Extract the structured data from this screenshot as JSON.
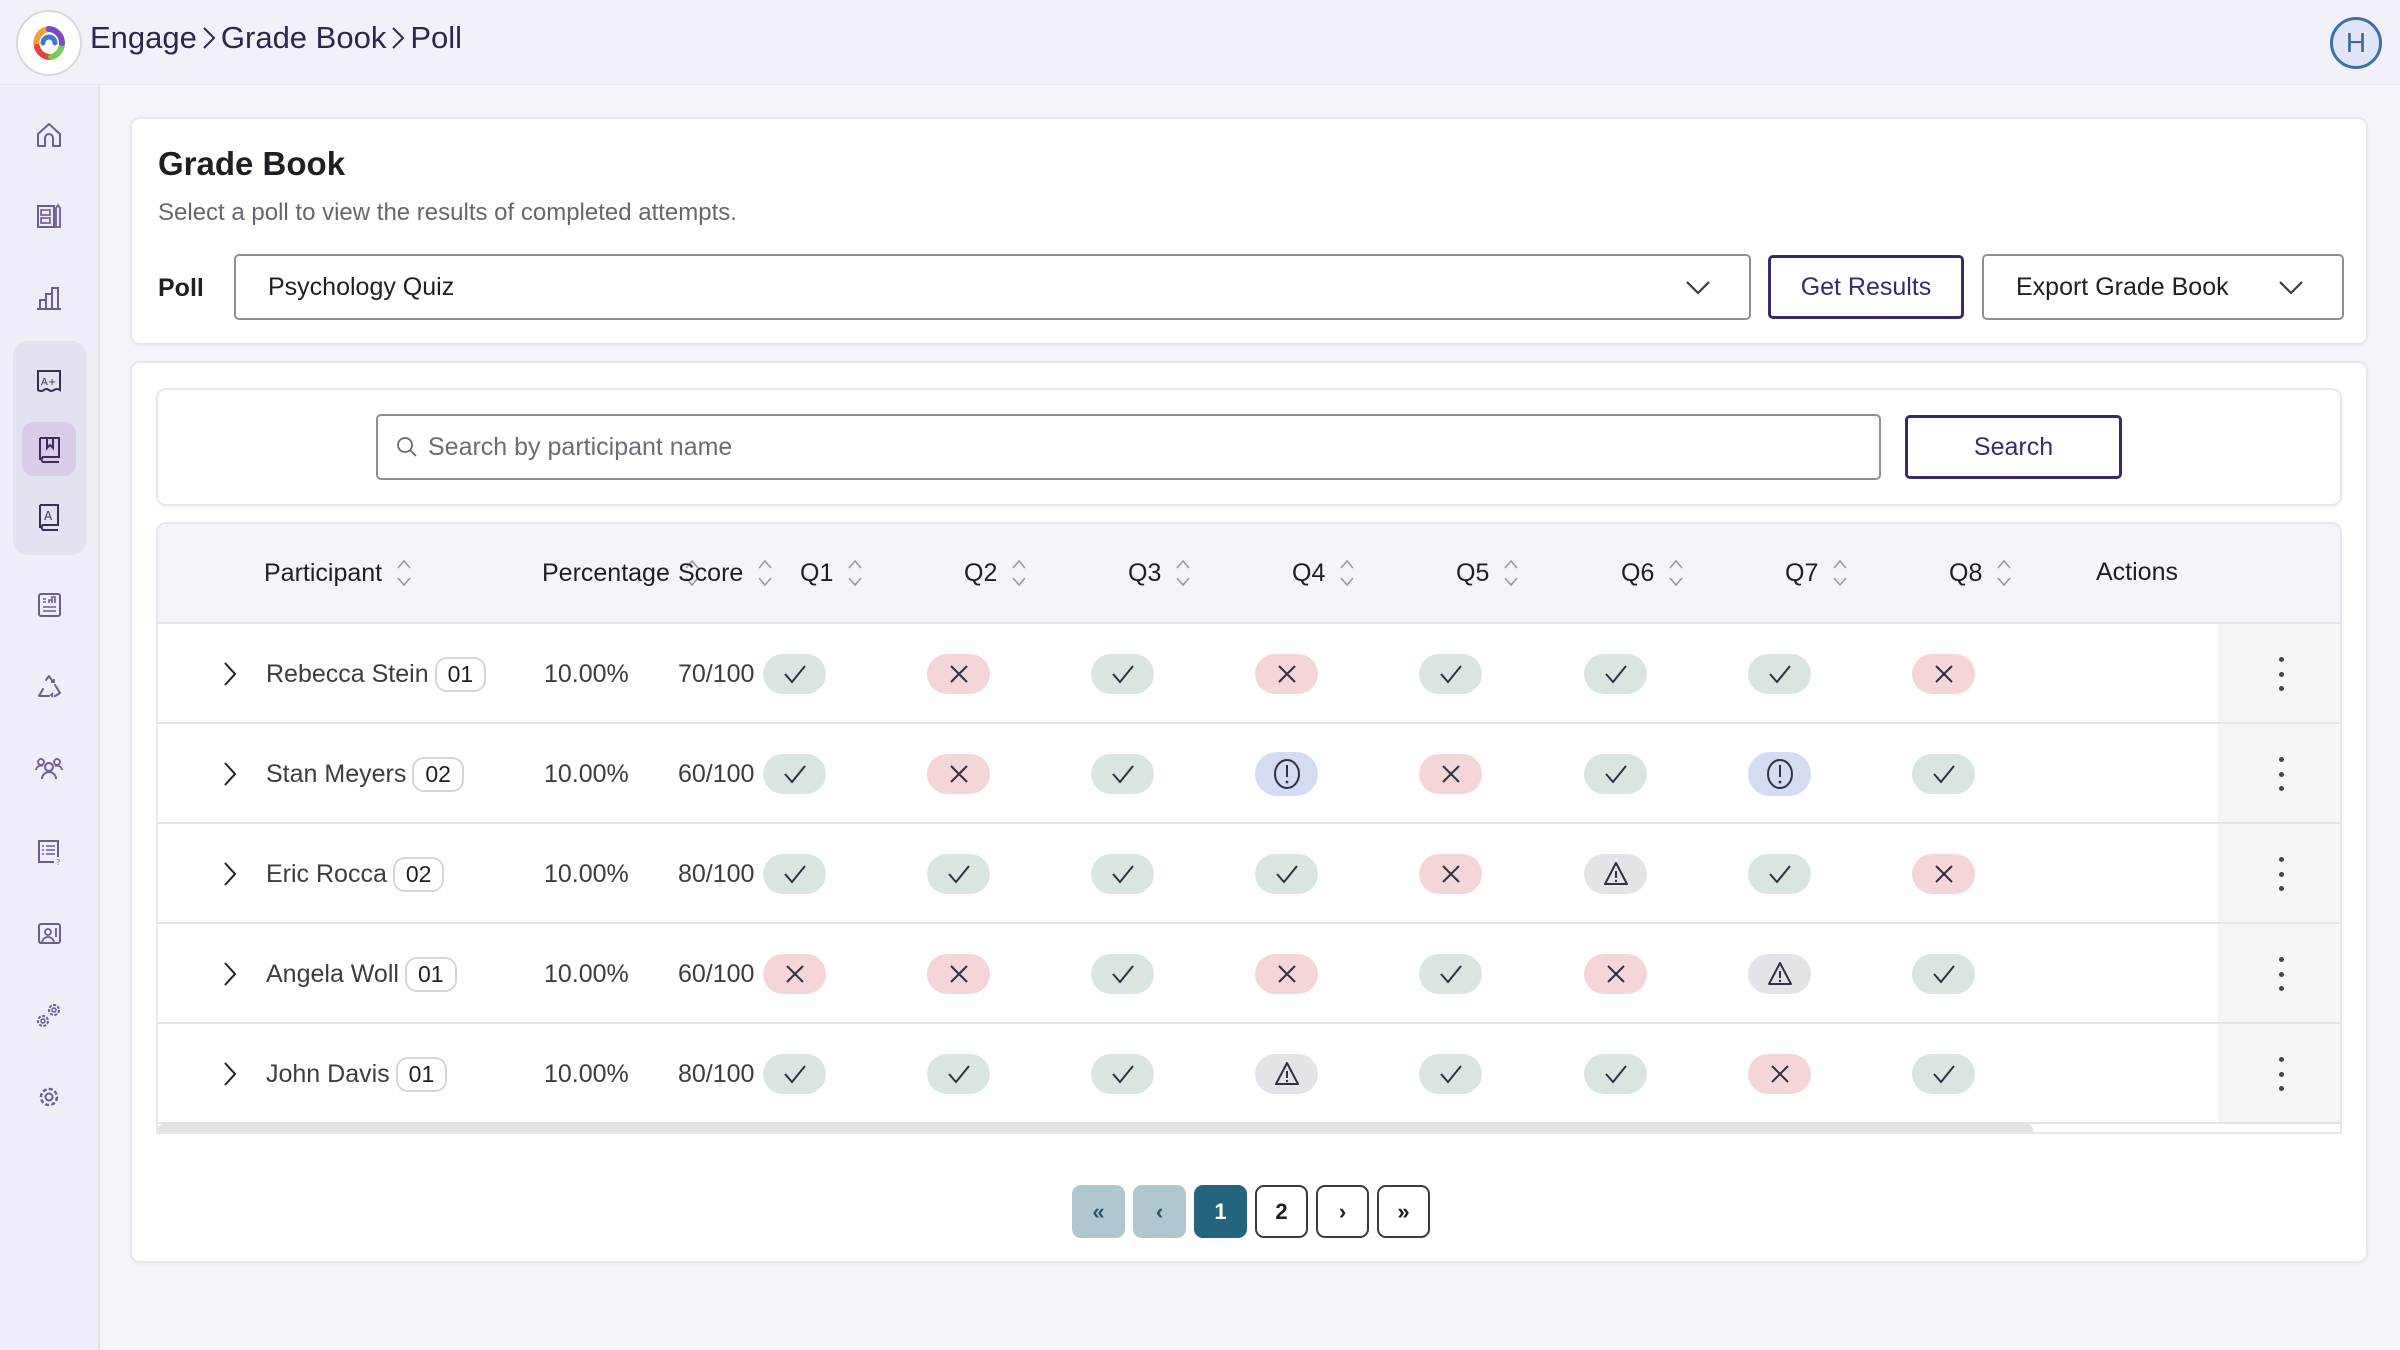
{
  "header": {
    "breadcrumb": [
      "Engage",
      "Grade Book",
      "Poll"
    ],
    "avatar_initial": "H"
  },
  "sidebar": {
    "items": [
      {
        "icon": "home-icon",
        "active": false
      },
      {
        "icon": "content-editor-icon",
        "active": false
      },
      {
        "icon": "bar-chart-icon",
        "active": false
      },
      {
        "icon": "grade-a-plus-icon",
        "active": false
      },
      {
        "icon": "gradebook-bookmark-icon",
        "active": true
      },
      {
        "icon": "grade-a-book-icon",
        "active": false
      },
      {
        "icon": "report-icon",
        "active": false
      },
      {
        "icon": "recycle-icon",
        "active": false
      },
      {
        "icon": "users-icon",
        "active": false
      },
      {
        "icon": "quiz-list-icon",
        "active": false
      },
      {
        "icon": "classroom-icon",
        "active": false
      },
      {
        "icon": "integrations-gears-icon",
        "active": false
      },
      {
        "icon": "settings-gear-icon",
        "active": false
      }
    ]
  },
  "gradebook": {
    "title": "Grade Book",
    "subtitle": "Select a poll to view the results of completed attempts.",
    "poll_label": "Poll",
    "poll_selected": "Psychology Quiz",
    "get_results_label": "Get Results",
    "export_label": "Export Grade Book"
  },
  "search": {
    "placeholder": "Search by participant name",
    "button_label": "Search"
  },
  "table": {
    "columns": [
      "Participant",
      "Percentage",
      "Score",
      "Q1",
      "Q2",
      "Q3",
      "Q4",
      "Q5",
      "Q6",
      "Q7",
      "Q8",
      "Actions"
    ],
    "rows": [
      {
        "name": "Rebecca Stein",
        "attempt": "01",
        "percentage": "10.00%",
        "score": "70/100",
        "answers": [
          "correct",
          "incorrect",
          "correct",
          "incorrect",
          "correct",
          "correct",
          "correct",
          "incorrect"
        ]
      },
      {
        "name": "Stan Meyers",
        "attempt": "02",
        "percentage": "10.00%",
        "score": "60/100",
        "answers": [
          "correct",
          "incorrect",
          "correct",
          "info",
          "incorrect",
          "correct",
          "info",
          "correct"
        ]
      },
      {
        "name": "Eric Rocca",
        "attempt": "02",
        "percentage": "10.00%",
        "score": "80/100",
        "answers": [
          "correct",
          "correct",
          "correct",
          "correct",
          "incorrect",
          "warning",
          "correct",
          "incorrect"
        ]
      },
      {
        "name": "Angela Woll",
        "attempt": "01",
        "percentage": "10.00%",
        "score": "60/100",
        "answers": [
          "incorrect",
          "incorrect",
          "correct",
          "incorrect",
          "correct",
          "incorrect",
          "warning",
          "correct"
        ]
      },
      {
        "name": "John Davis",
        "attempt": "01",
        "percentage": "10.00%",
        "score": "80/100",
        "answers": [
          "correct",
          "correct",
          "correct",
          "warning",
          "correct",
          "correct",
          "incorrect",
          "correct"
        ]
      }
    ]
  },
  "pagination": {
    "first_label": "«",
    "prev_label": "‹",
    "pages": [
      "1",
      "2"
    ],
    "current_page": "1",
    "next_label": "›",
    "last_label": "»"
  },
  "colors": {
    "accent": "#3a2a6b",
    "correct_bg": "#d9e6df",
    "incorrect_bg": "#f5d6d8",
    "info_bg": "#d3dcf2",
    "warning_bg": "#e4e4e8",
    "page_current": "#24647c",
    "page_disabled": "#afc7cf"
  }
}
